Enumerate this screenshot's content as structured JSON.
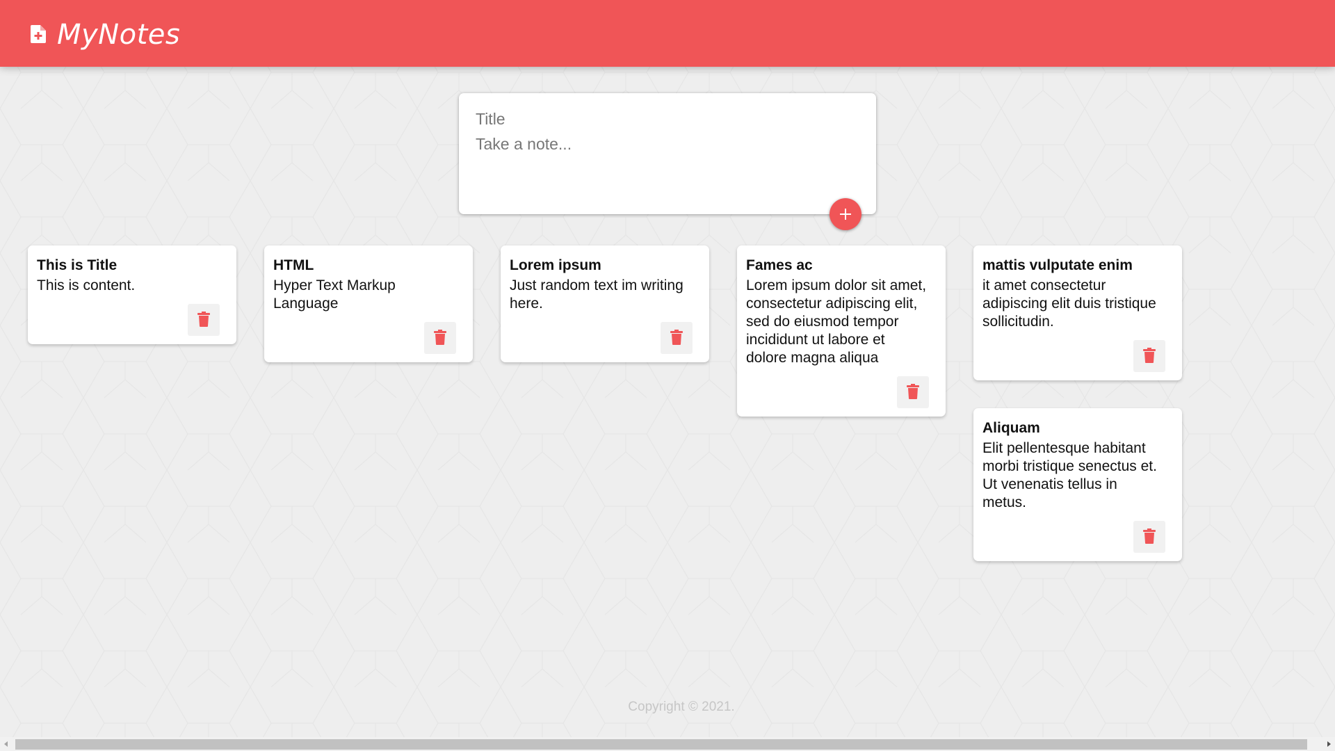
{
  "header": {
    "title": "MyNotes",
    "icon": "note-add-icon"
  },
  "create_area": {
    "title_placeholder": "Title",
    "content_placeholder": "Take a note...",
    "add_button_icon": "plus-icon"
  },
  "notes": [
    {
      "title": "This is Title",
      "content": "This is content."
    },
    {
      "title": "HTML",
      "content": "Hyper Text Markup\nLanguage"
    },
    {
      "title": "Lorem ipsum",
      "content": "Just random text im writing\nhere."
    },
    {
      "title": "Fames ac",
      "content": "Lorem ipsum dolor sit amet,\nconsectetur adipiscing elit,\nsed do eiusmod tempor\nincididunt ut labore et\ndolore magna aliqua"
    },
    {
      "title": "mattis vulputate enim",
      "content": "it amet consectetur\nadipiscing elit duis tristique\nsollicitudin."
    },
    {
      "title": "Aliquam",
      "content": "Elit pellentesque habitant\nmorbi tristique senectus et.\nUt venenatis tellus in\nmetus."
    }
  ],
  "delete_icon": "trash-icon",
  "footer": {
    "text": "Copyright © 2021."
  },
  "colors": {
    "accent": "#f05557",
    "background": "#eeeeee",
    "card": "#ffffff"
  }
}
